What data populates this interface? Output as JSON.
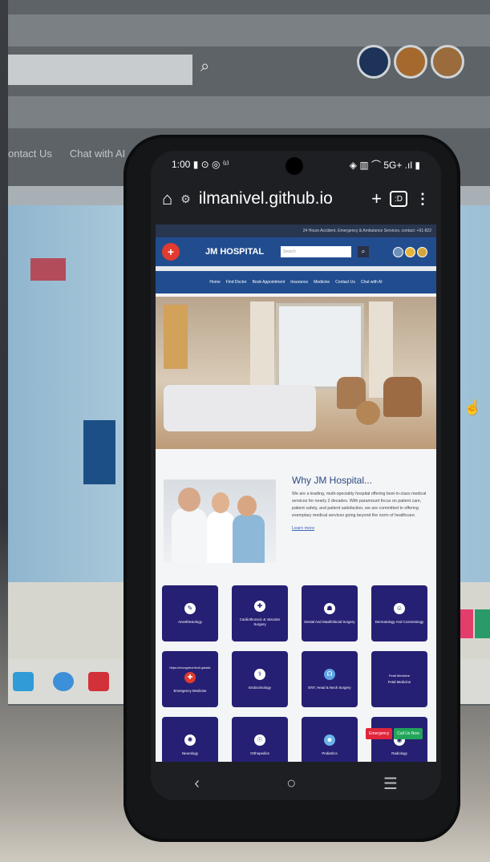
{
  "monitor": {
    "search_button": "⌕",
    "nav": [
      "ontact Us",
      "Chat with AI"
    ]
  },
  "phone": {
    "status": {
      "time": "1:00",
      "icons": "▮ ⊙ ◎ ⁽ᶦ⁾",
      "right": "◈ ▥ ⌒ 5G+ .ıl ▮"
    },
    "browser": {
      "url": "ilmanivel.github.io",
      "tab_count": ":D",
      "home_icon": "⌂",
      "tune_icon": "⚙",
      "plus_icon": "+",
      "menu_icon": "⋮"
    },
    "site": {
      "ticker": "24 Hours Accident, Emergency & Ambulance Services, contact: +91-822",
      "brand": "JM HOSPITAL",
      "search_placeholder": "Search",
      "search_button": "⌕",
      "nav": [
        "Home",
        "Find Doctor",
        "Book Appointment",
        "Insurance",
        "Medicine",
        "Contact Us",
        "Chat with AI"
      ],
      "why": {
        "title": "Why JM Hospital...",
        "body": "We are a leading, multi-speciality hospital offering best-in-class medical services for nearly 2 decades. With paramount focus on patient care, patient safety, and patient satisfaction, we are committed to offering exemplary medical services going beyond the norm of healthcare.",
        "link": "Learn more"
      },
      "departments": [
        {
          "extra": "",
          "label": "Anesthesiology",
          "icon": "✎"
        },
        {
          "extra": "",
          "label": "Cardiothoracic & Vascular Surgery",
          "icon": "✚"
        },
        {
          "extra": "",
          "label": "Dental And Maxillofacial Surgery",
          "icon": "☗"
        },
        {
          "extra": "",
          "label": "Dermatology And Cosmetology",
          "icon": "☺"
        },
        {
          "extra": "https://encrypted-tbn0.gstatic",
          "label": "Emergency Medicine",
          "icon": "✚"
        },
        {
          "extra": "",
          "label": "Endocrinology",
          "icon": "⚕"
        },
        {
          "extra": "",
          "label": "ENT, Head & Neck Surgery",
          "icon": "☊"
        },
        {
          "extra": "Fetal Medicine",
          "label": "Fetal Medicine",
          "icon": "♡"
        },
        {
          "extra": "",
          "label": "Neurology",
          "icon": "✺"
        },
        {
          "extra": "",
          "label": "Orthopedics",
          "icon": "☉"
        },
        {
          "extra": "",
          "label": "Pediatrics",
          "icon": "☻"
        },
        {
          "extra": "",
          "label": "Radiology",
          "icon": "◉"
        }
      ],
      "emergency_label": "Emergency",
      "call_label": "Call Us Now"
    },
    "system_nav": {
      "back": "‹",
      "home": "○",
      "recents": "☰"
    }
  }
}
